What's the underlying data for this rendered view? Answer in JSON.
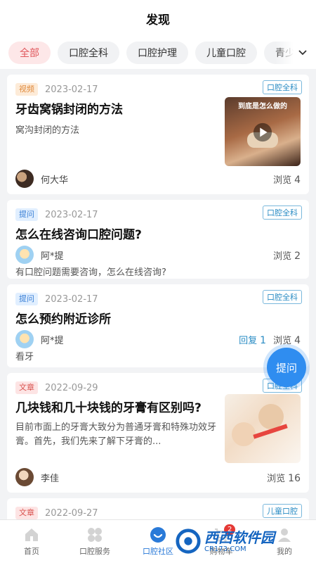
{
  "header": {
    "title": "发现"
  },
  "categories": [
    {
      "label": "全部",
      "active": true
    },
    {
      "label": "口腔全科",
      "active": false
    },
    {
      "label": "口腔护理",
      "active": false
    },
    {
      "label": "儿童口腔",
      "active": false
    },
    {
      "label": "青少",
      "active": false
    }
  ],
  "posts": [
    {
      "type": "视频",
      "date": "2023-02-17",
      "category": "口腔全科",
      "title": "牙齿窝锅封闭的方法",
      "desc": "窝沟封闭的方法",
      "author": "何大华",
      "views_label": "浏览",
      "views": "4",
      "thumb_caption": "到底是怎么做的"
    },
    {
      "type": "提问",
      "date": "2023-02-17",
      "category": "口腔全科",
      "title": "怎么在线咨询口腔问题?",
      "author": "阿*提",
      "views_label": "浏览",
      "views": "2",
      "desc": "有口腔问题需要咨询，怎么在线咨询?"
    },
    {
      "type": "提问",
      "date": "2023-02-17",
      "category": "口腔全科",
      "title": "怎么预约附近诊所",
      "author": "阿*提",
      "reply_label": "回复",
      "replies": "1",
      "views_label": "浏览",
      "views": "4",
      "desc": "看牙"
    },
    {
      "type": "文章",
      "date": "2022-09-29",
      "category": "口腔全科",
      "title": "几块钱和几十块钱的牙膏有区别吗?",
      "desc": "目前市面上的牙膏大致分为普通牙膏和特殊功效牙膏。首先，我们先来了解下牙膏的...",
      "author": "李佳",
      "views_label": "浏览",
      "views": "16"
    },
    {
      "type": "文章",
      "date": "2022-09-27",
      "category": "儿童口腔"
    }
  ],
  "fab": {
    "label": "提问"
  },
  "tabbar": [
    {
      "label": "首页",
      "icon": "home-icon"
    },
    {
      "label": "口腔服务",
      "icon": "clover-icon"
    },
    {
      "label": "口腔社区",
      "icon": "community-icon",
      "active": true
    },
    {
      "label": "购物车",
      "icon": "cart-icon",
      "badge": "2"
    },
    {
      "label": "我的",
      "icon": "profile-icon"
    }
  ],
  "watermark": {
    "brand": "西西软件园",
    "site": "CR173.COM"
  },
  "colors": {
    "accent": "#2f8df0",
    "active_chip": "#e0575c",
    "badge_blue": "#2a8cc4"
  }
}
